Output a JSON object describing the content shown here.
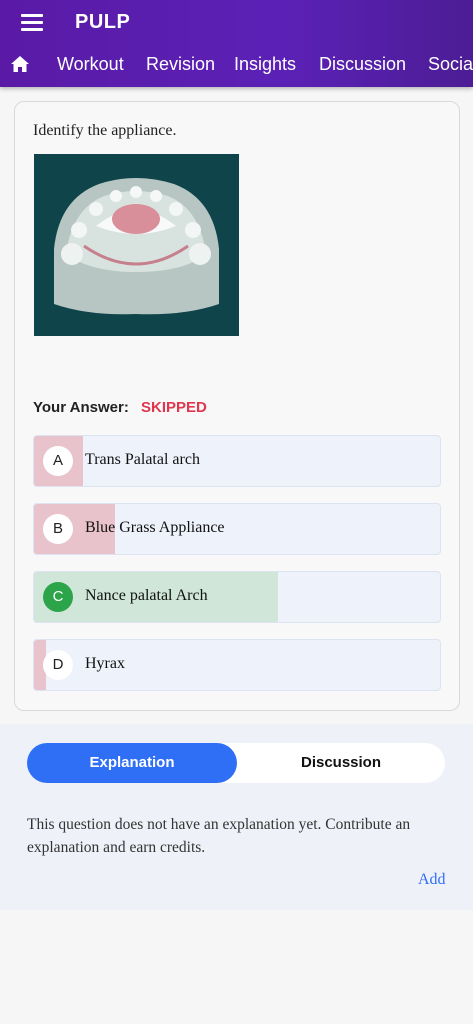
{
  "app": {
    "title": "PULP"
  },
  "nav": {
    "items": [
      "Workout",
      "Revision",
      "Insights",
      "Discussion",
      "Social"
    ]
  },
  "question": {
    "text": "Identify the appliance.",
    "image_alt": "Dental cast with palatal appliance"
  },
  "answer": {
    "label": "Your Answer:",
    "value": "SKIPPED"
  },
  "options": [
    {
      "letter": "A",
      "text": "Trans Palatal arch",
      "percent": 12,
      "color": "#e8c3cc",
      "badge_bg": "#ffffff",
      "badge_fg": "#222222"
    },
    {
      "letter": "B",
      "text": "Blue Grass Appliance",
      "percent": 20,
      "color": "#e8c3cc",
      "badge_bg": "#ffffff",
      "badge_fg": "#222222"
    },
    {
      "letter": "C",
      "text": "Nance palatal Arch",
      "percent": 60,
      "color": "#cfe6d8",
      "badge_bg": "#2ba44a",
      "badge_fg": "#ffffff"
    },
    {
      "letter": "D",
      "text": "Hyrax",
      "percent": 3,
      "color": "#e8c3cc",
      "badge_bg": "#ffffff",
      "badge_fg": "#222222"
    }
  ],
  "tabs": {
    "active": "Explanation",
    "other": "Discussion"
  },
  "explanation": {
    "text": "This question does not have an explanation yet. Contribute an explanation and earn credits.",
    "add_label": "Add"
  },
  "colors": {
    "accent": "#5b21b6",
    "primary_blue": "#2f6ff5",
    "skipped": "#e0364e",
    "correct": "#2ba44a"
  }
}
